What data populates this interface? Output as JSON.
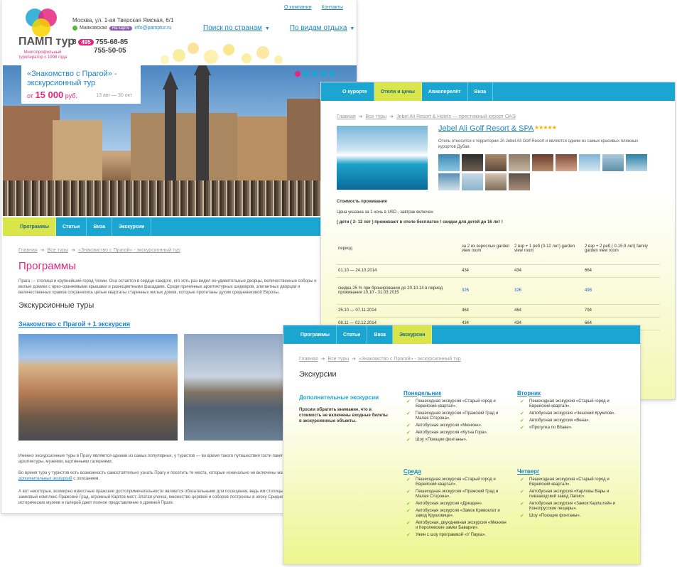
{
  "colors": {
    "accent": "#1ba6d2",
    "pink": "#e4267c",
    "lime": "#d9e54a",
    "link": "#1d84c8"
  },
  "site": {
    "brand": "ПАМП тур",
    "tagline": "Многопрофильный туроператор с 1998 года",
    "address": "Москва, ул. 1-ая Тверская Ямская, 6/1",
    "metro": "Маяковская",
    "map_label": "На карте",
    "email": "info@pamptur.ru",
    "phone_prefix": "8",
    "phone_code": "495",
    "phone1": "755-68-85",
    "phone2": "755-50-05",
    "top_links": [
      "О компании",
      "Контакты"
    ],
    "main_nav": [
      "Поиск по странам",
      "По видам отдыха"
    ]
  },
  "promo": {
    "title": "«Знакомство с Прагой» - экскурсионный тур",
    "price_prefix": "от",
    "price": "15 000",
    "currency": "руб.",
    "dates": "13 авг — 30 окт"
  },
  "page1": {
    "nav": [
      "Программы",
      "Статьи",
      "Виза",
      "Экскурсии"
    ],
    "crumbs": [
      "Главная",
      "Все туры",
      "«Знакомство с Прагой» - экскурсионный тур"
    ],
    "title": "Программы",
    "intro": "Прага — столица и крупнейший город Чехии. Она остается в сердце каждого, кто хоть раз видел ее удивительные дворцы, величественные соборы и милые домики с ярко-оранжевыми крышами и разноцветными фасадами. Среди причинных архитектурных шедевров, элегантных дворцов и величественных храмов сохранились целые кварталы старинных жилых домов, которые пропитаны духом средневековой Европы.",
    "section": "Экскурсионные туры",
    "tour_link": "Знакомство с Прагой + 1 экскурсия",
    "p1": "Именно экскурсионные туры в Прагу являются одними из самых популярных, у туристов — во время такого путешествия гости памятниками культуры и архитектуры, музеями, картинными галереями.",
    "p2_a": "Во время тура у туристов есть возможность самостоятельно узнать Прагу и посетить те места, которые изначально не включены маршрут. Список",
    "p2_link": "дополнительных экскурсий",
    "p2_b": "с описанием.",
    "p3": "А вот некоторые, всемирно известные пражские достопримечательности являются обязательными для посещения, ведь им столицы и всей Чехии: замковый комплекс Пражский Град, огромный Карлов мост, Златая улочка, множество церквей и соборов построены в эпоху Средневековья. Множество исторических музеев и галерей дают полное представление о древней Праге."
  },
  "page2": {
    "nav": [
      "О курорте",
      "Отели и цены",
      "Авиаперелёт",
      "Виза"
    ],
    "crumbs": [
      "Главная",
      "Все туры",
      "Jebel Ali Resort & Hotels — престижный курорт ОАЭ"
    ],
    "hotel": "Jebel Ali Golf Resort & SPA",
    "stars": "★★★★★",
    "desc": "Отель относится к территории JA Jebel Ali Golf Resort и является одним из самых красивых пляжных курортов Дубая.",
    "cost_label": "Стоимость проживания",
    "price_note": "Цена указана за 1 ночь в USD , завтрак включен",
    "kids_note": "( дети ( 2- 12 лет ) проживают в отеле бесплатно ! скидки для детей до 16 лет !",
    "table": {
      "headers": [
        "период",
        "за 2 их взрослых garden view room",
        "2 взр + 1 реб (0-12 лет) garden view room",
        "2 взр + 2 реб ( 0-15.9 лет) family garden view room"
      ],
      "rows": [
        [
          "01.10 — 24.10.2014",
          "434",
          "434",
          "664"
        ],
        [
          "скидка 25 % при бронировании до 20.10.14 в период проживания 10.10 - 31.03.2015",
          "326",
          "326",
          "498"
        ],
        [
          "25.10 — 07.11.2014",
          "464",
          "464",
          "794"
        ],
        [
          "08.11 — 02.12.2014",
          "434",
          "434",
          "664"
        ]
      ]
    }
  },
  "page3": {
    "nav": [
      "Программы",
      "Статьи",
      "Виза",
      "Экскурсии"
    ],
    "crumbs": [
      "Главная",
      "Все туры",
      "«Знакомство с Прагой» - экскурсионный тур"
    ],
    "title": "Экскурсии",
    "add_title": "Дополнительные экскурсии",
    "add_note": "Просим обратить внимание, что в стоимость не включены входные билеты в экскурсионные объекты.",
    "days": [
      {
        "name": "Понедельник",
        "items": [
          "Пешеходная экскурсия «Старый город и Еврейский квартал».",
          "Пешеходная экскурсия «Пражский Град и Малая Сторона».",
          "Автобусная экскурсия «Мюнхен».",
          "Автобусная экскурсия «Кутна Гора».",
          "Шоу «Поющие фонтаны»."
        ]
      },
      {
        "name": "Вторник",
        "items": [
          "Пешеходная экскурсия «Старый город и Еврейский квартал».",
          "Автобусная экскурсия «Чешский Крумлов».",
          "Автобусная экскурсия «Вена».",
          "«Прогулка по Вltаве»."
        ]
      },
      {
        "name": "Среда",
        "items": [
          "Пешеходная экскурсия «Старый город и Еврейский квартал».",
          "Пешеходная экскурсия «Пражский Град и Малая Сторона».",
          "Автобусная экскурсия «Дрезден».",
          "Автобусная экскурсия «Замок Кривоклат и завод Крушовице».",
          "Автобусная, двухдневная экскурсия «Мюнхен и Королевские замки Баварии».",
          "Ужин с шоу программой «У Паука»."
        ]
      },
      {
        "name": "Четверг",
        "items": [
          "Пешеходная экскурсия «Старый город и Еврейский квартал».",
          "Автобусная экскурсия «Карловы Вары и пивзаводский завод Лапис».",
          "Автобусная экскурсия «Замок Карлштейн и Конопрусские пещеры».",
          "Шоу «Поющие фонтаны»."
        ]
      }
    ]
  }
}
